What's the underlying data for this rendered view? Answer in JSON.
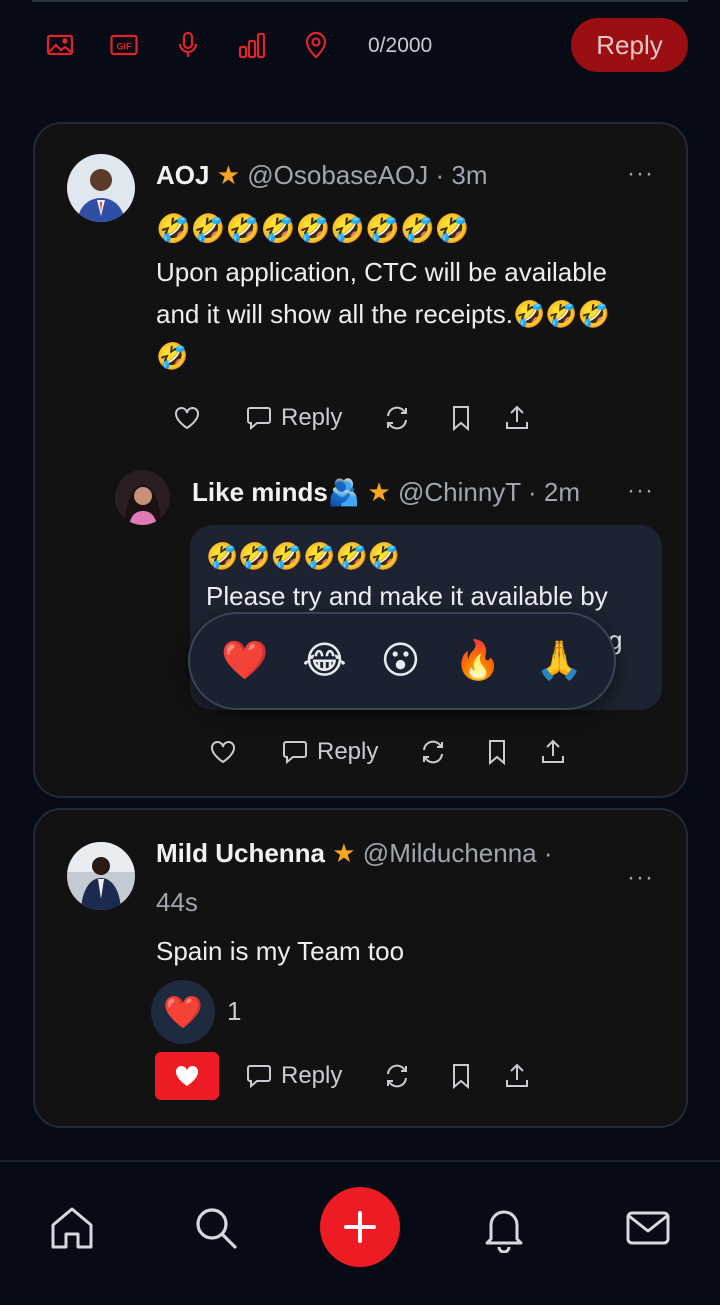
{
  "composer": {
    "counter": "0/2000",
    "reply_label": "Reply",
    "tools": [
      "image-icon",
      "gif-icon",
      "mic-icon",
      "poll-icon",
      "location-icon"
    ],
    "gif_text": "GIF"
  },
  "posts": [
    {
      "name": "AOJ",
      "handle": "@OsobaseAOJ",
      "time": "3m",
      "emoji_line": "🤣🤣🤣🤣🤣🤣🤣🤣🤣",
      "text_line1": "Upon application, CTC will be available",
      "text_line2": "and it will show all the receipts.🤣🤣🤣",
      "text_line3": "🤣",
      "reply_label": "Reply",
      "replies": [
        {
          "name": "Like minds🫂",
          "handle": "@ChinnyT",
          "time": "2m",
          "emoji_line": "🤣🤣🤣🤣🤣🤣",
          "text_line1": "Please try and make it available by",
          "text_line2_fragment": "g",
          "reply_label": "Reply"
        }
      ]
    },
    {
      "name": "Mild Uchenna",
      "handle": "@Milduchenna",
      "time": "44s",
      "text": "Spain is my Team too",
      "reaction_emoji": "❤️",
      "reaction_count": "1",
      "reply_label": "Reply"
    }
  ],
  "reaction_picker": [
    "❤️",
    "😂",
    "😮",
    "🔥",
    "🙏"
  ],
  "separator": "·",
  "star": "★",
  "more": "···",
  "nav": [
    "home-icon",
    "search-icon",
    "create-icon",
    "bell-icon",
    "mail-icon"
  ],
  "colors": {
    "accent": "#ed1c24",
    "reply_button": "#9b0e12",
    "star": "#f5a623"
  }
}
